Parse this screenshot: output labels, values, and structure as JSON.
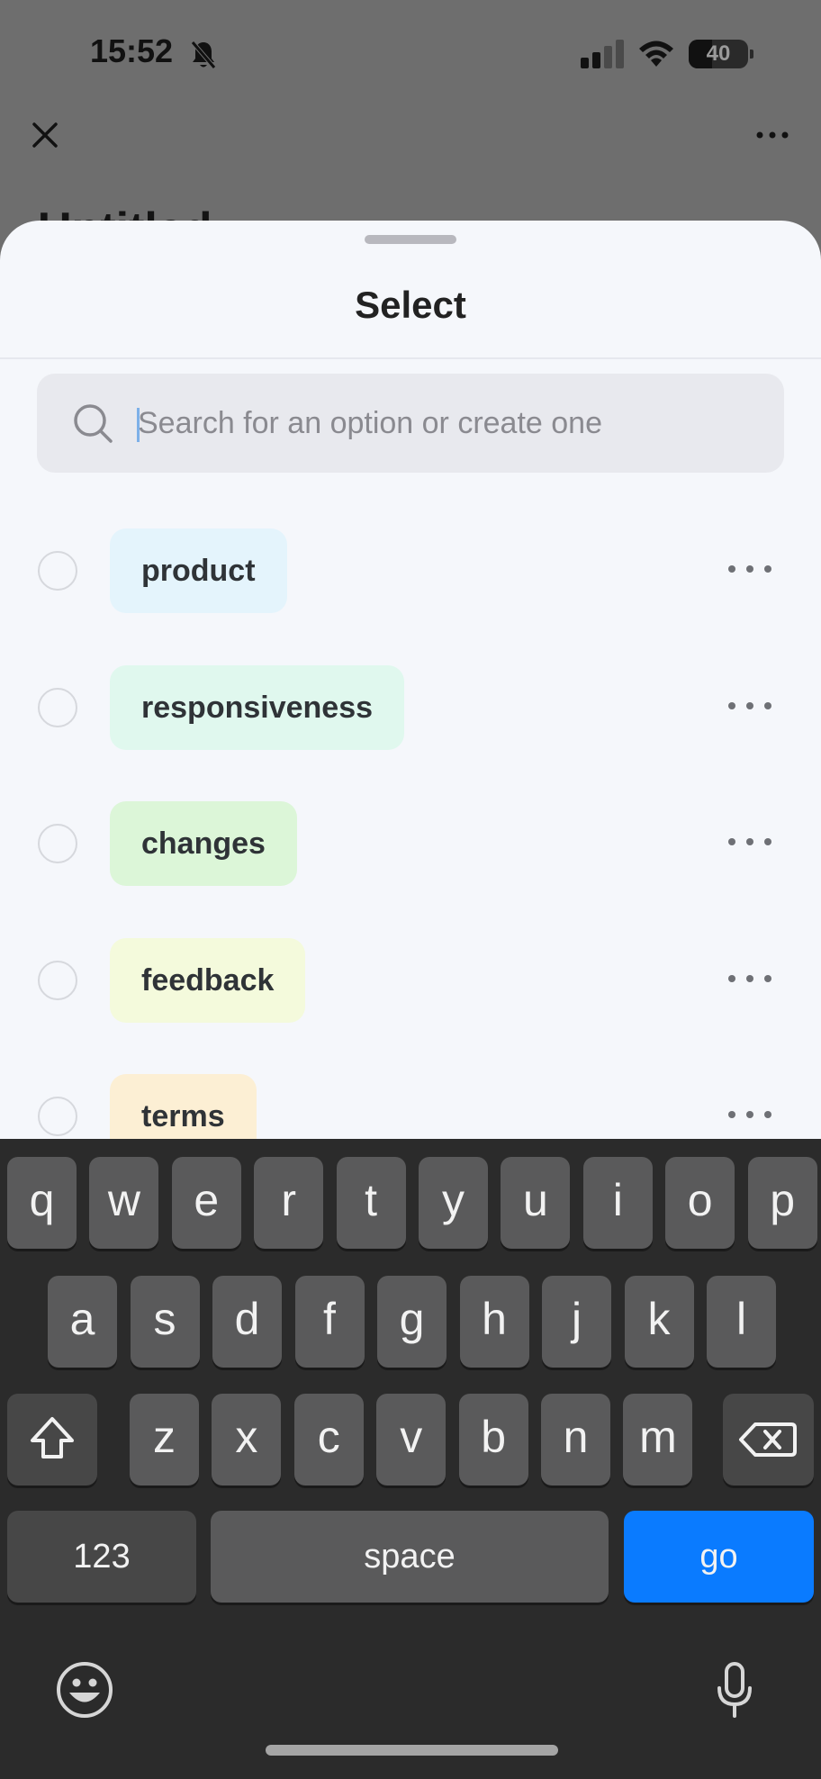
{
  "status_bar": {
    "time": "15:52",
    "battery": "40",
    "battery_level": 0.4
  },
  "page": {
    "title_partial": "Untitled"
  },
  "sheet": {
    "title": "Select",
    "search_placeholder": "Search for an option or create one",
    "options": [
      {
        "label": "product",
        "color": "#e4f4fc"
      },
      {
        "label": "responsiveness",
        "color": "#e0f8ee"
      },
      {
        "label": "changes",
        "color": "#dcf6d8"
      },
      {
        "label": "feedback",
        "color": "#f4fadc"
      },
      {
        "label": "terms",
        "color": "#fcefd4"
      }
    ]
  },
  "keyboard": {
    "row1": [
      "q",
      "w",
      "e",
      "r",
      "t",
      "y",
      "u",
      "i",
      "o",
      "p"
    ],
    "row2": [
      "a",
      "s",
      "d",
      "f",
      "g",
      "h",
      "j",
      "k",
      "l"
    ],
    "row3": [
      "z",
      "x",
      "c",
      "v",
      "b",
      "n",
      "m"
    ],
    "numbers_key": "123",
    "space_key": "space",
    "go_key": "go",
    "go_color": "#0a7bff",
    "icons": [
      "shift-icon",
      "delete-icon",
      "emoji-icon",
      "microphone-icon"
    ]
  }
}
